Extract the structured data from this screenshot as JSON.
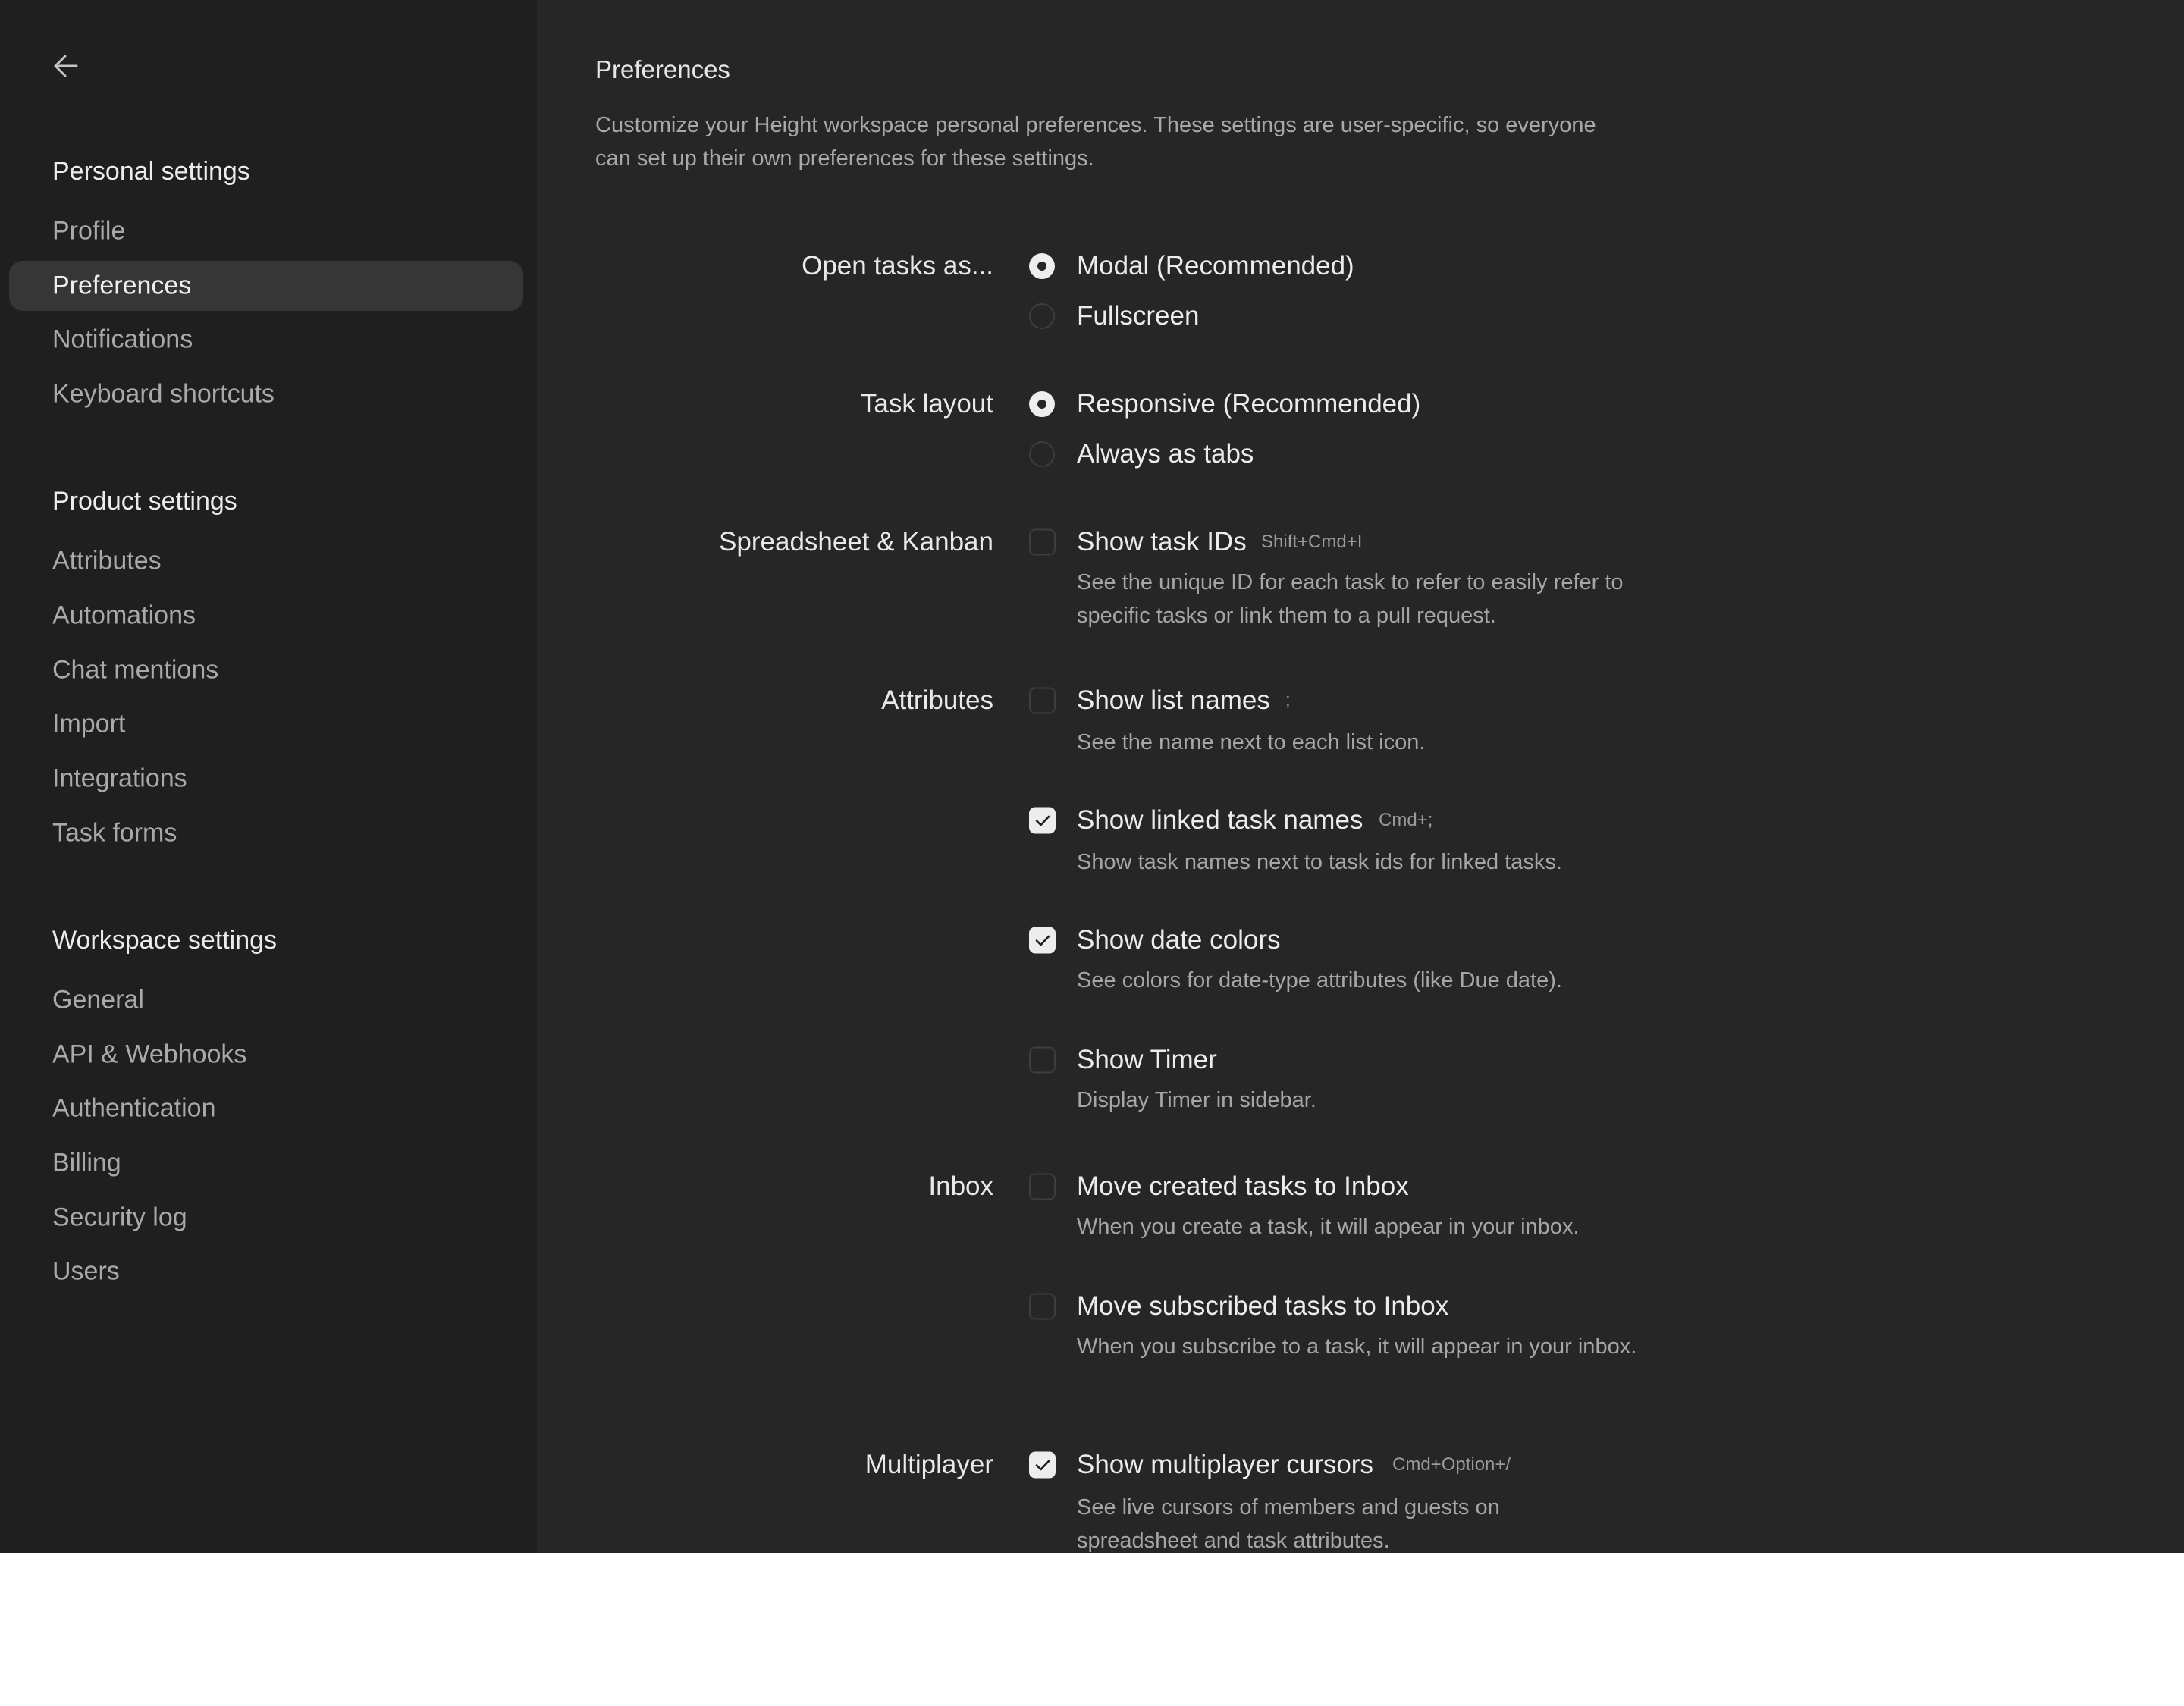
{
  "sidebar": {
    "back_icon": "arrow-left-icon",
    "sections": [
      {
        "title": "Personal settings",
        "items": [
          {
            "label": "Profile",
            "active": false
          },
          {
            "label": "Preferences",
            "active": true
          },
          {
            "label": "Notifications",
            "active": false
          },
          {
            "label": "Keyboard shortcuts",
            "active": false
          }
        ]
      },
      {
        "title": "Product settings",
        "items": [
          {
            "label": "Attributes",
            "active": false
          },
          {
            "label": "Automations",
            "active": false
          },
          {
            "label": "Chat mentions",
            "active": false
          },
          {
            "label": "Import",
            "active": false
          },
          {
            "label": "Integrations",
            "active": false
          },
          {
            "label": "Task forms",
            "active": false
          }
        ]
      },
      {
        "title": "Workspace settings",
        "items": [
          {
            "label": "General",
            "active": false
          },
          {
            "label": "API & Webhooks",
            "active": false
          },
          {
            "label": "Authentication",
            "active": false
          },
          {
            "label": "Billing",
            "active": false
          },
          {
            "label": "Security log",
            "active": false
          },
          {
            "label": "Users",
            "active": false
          }
        ]
      }
    ]
  },
  "main": {
    "title": "Preferences",
    "description": "Customize your Height workspace personal preferences. These settings are user-specific, so everyone can set up their own preferences for these settings.",
    "open_tasks": {
      "label": "Open tasks as...",
      "options": [
        {
          "label": "Modal (Recommended)",
          "selected": true
        },
        {
          "label": "Fullscreen",
          "selected": false
        }
      ]
    },
    "task_layout": {
      "label": "Task layout",
      "options": [
        {
          "label": "Responsive (Recommended)",
          "selected": true
        },
        {
          "label": "Always as tabs",
          "selected": false
        }
      ]
    },
    "spreadsheet_kanban": {
      "label": "Spreadsheet & Kanban",
      "show_task_ids": {
        "label": "Show task IDs",
        "shortcut": "Shift+Cmd+I",
        "checked": false,
        "description": "See the unique ID for each task to refer to easily refer to specific tasks or link them to a pull request."
      }
    },
    "attributes": {
      "label": "Attributes",
      "show_list_names": {
        "label": "Show list names",
        "shortcut": ";",
        "checked": false,
        "description": "See the name next to each list icon."
      },
      "show_linked_task_names": {
        "label": "Show linked task names",
        "shortcut": "Cmd+;",
        "checked": true,
        "description": "Show task names next to task ids for linked tasks."
      },
      "show_date_colors": {
        "label": "Show date colors",
        "checked": true,
        "description": "See colors for date-type attributes (like Due date)."
      },
      "show_timer": {
        "label": "Show Timer",
        "checked": false,
        "description": "Display Timer in sidebar."
      }
    },
    "inbox": {
      "label": "Inbox",
      "move_created": {
        "label": "Move created tasks to Inbox",
        "checked": false,
        "description": "When you create a task, it will appear in your inbox."
      },
      "move_subscribed": {
        "label": "Move subscribed tasks to Inbox",
        "checked": false,
        "description": "When you subscribe to a task, it will appear in your inbox."
      }
    },
    "multiplayer": {
      "label": "Multiplayer",
      "show_cursors": {
        "label": "Show multiplayer cursors",
        "shortcut": "Cmd+Option+/",
        "checked": true,
        "description": "See live cursors of members and guests on spreadsheet and task attributes."
      }
    }
  }
}
